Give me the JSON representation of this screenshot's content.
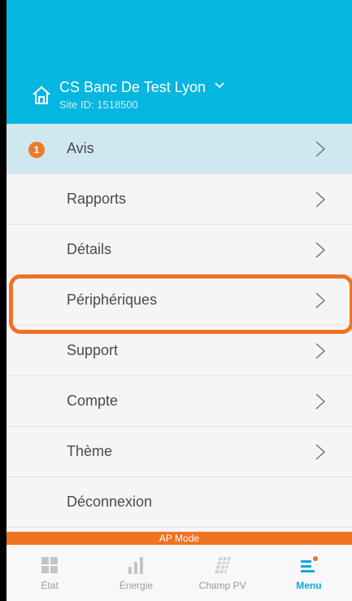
{
  "header": {
    "site_name": "CS Banc De Test Lyon",
    "site_id": "Site ID: 1518500"
  },
  "menu": {
    "items": [
      {
        "label": "Avis",
        "badge": "1"
      },
      {
        "label": "Rapports"
      },
      {
        "label": "Détails"
      },
      {
        "label": "Périphériques"
      },
      {
        "label": "Support"
      },
      {
        "label": "Compte"
      },
      {
        "label": "Thème"
      },
      {
        "label": "Déconnexion"
      }
    ]
  },
  "ap_mode": "AP Mode",
  "bottom_nav": {
    "items": [
      {
        "label": "État",
        "icon": "grid-icon"
      },
      {
        "label": "Énergie",
        "icon": "bar-chart-icon"
      },
      {
        "label": "Champ PV",
        "icon": "solar-panel-icon"
      },
      {
        "label": "Menu",
        "icon": "menu-icon"
      }
    ],
    "selected": "Menu"
  },
  "colors": {
    "header": "#05b6e0",
    "accent": "#ee7324",
    "active_item": "#cfe8f0",
    "nav_selected": "#0ea8d8"
  }
}
